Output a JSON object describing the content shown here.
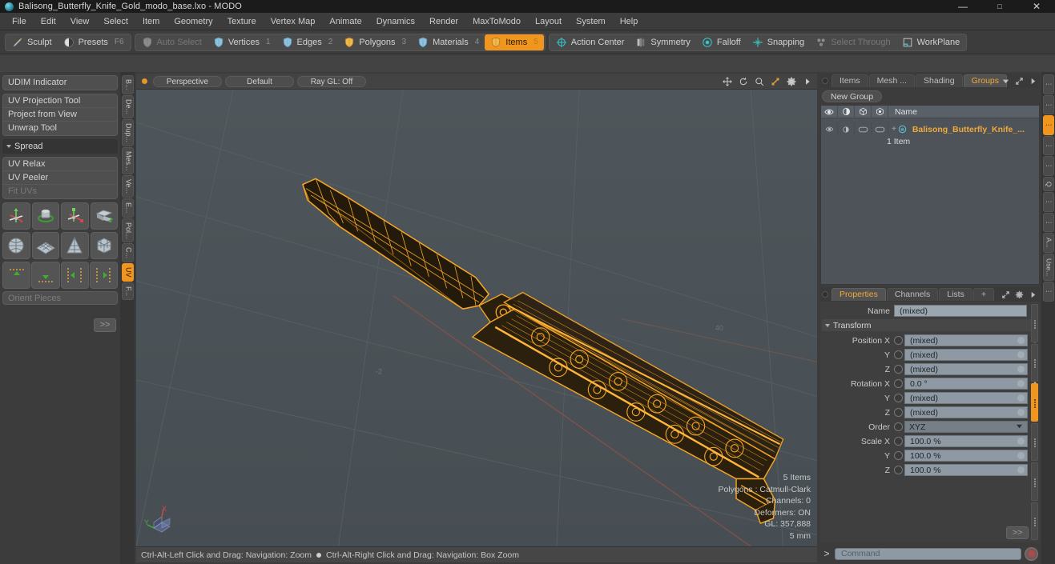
{
  "window": {
    "title": "Balisong_Butterfly_Knife_Gold_modo_base.lxo - MODO",
    "app_icon": "modo-sphere-icon",
    "minimize": "—",
    "maximize": "▢",
    "close": "✕"
  },
  "menubar": {
    "items": [
      "File",
      "Edit",
      "View",
      "Select",
      "Item",
      "Geometry",
      "Texture",
      "Vertex Map",
      "Animate",
      "Dynamics",
      "Render",
      "MaxToModo",
      "Layout",
      "System",
      "Help"
    ]
  },
  "toolbar": {
    "group_left": [
      {
        "label": "Sculpt",
        "icon": "sculpt-brush-icon",
        "state": "normal",
        "shortcut": ""
      },
      {
        "label": "Presets",
        "icon": "presets-sphere-icon",
        "state": "normal",
        "shortcut": "F6"
      }
    ],
    "group_mode": [
      {
        "label": "Auto Select",
        "icon": "shield-icon",
        "state": "dim",
        "shortcut": ""
      },
      {
        "label": "Vertices",
        "icon": "shield-icon",
        "state": "normal",
        "shortcut": "1"
      },
      {
        "label": "Edges",
        "icon": "shield-icon",
        "state": "normal",
        "shortcut": "2"
      },
      {
        "label": "Polygons",
        "icon": "shield-icon",
        "state": "normal",
        "shortcut": "3"
      },
      {
        "label": "Materials",
        "icon": "shield-icon",
        "state": "normal",
        "shortcut": "4"
      },
      {
        "label": "Items",
        "icon": "shield-icon",
        "state": "active",
        "shortcut": "5"
      }
    ],
    "group_right": [
      {
        "label": "Action Center",
        "icon": "action-center-icon",
        "state": "normal"
      },
      {
        "label": "Symmetry",
        "icon": "symmetry-icon",
        "state": "normal"
      },
      {
        "label": "Falloff",
        "icon": "falloff-icon",
        "state": "normal"
      },
      {
        "label": "Snapping",
        "icon": "snapping-icon",
        "state": "normal"
      },
      {
        "label": "Select Through",
        "icon": "select-through-icon",
        "state": "dim"
      },
      {
        "label": "WorkPlane",
        "icon": "workplane-icon",
        "state": "normal"
      }
    ]
  },
  "left_panel": {
    "group_one": [
      {
        "label": "UDIM Indicator",
        "disabled": false
      }
    ],
    "group_two": [
      {
        "label": "UV Projection Tool",
        "disabled": false
      },
      {
        "label": "Project from View",
        "disabled": false
      },
      {
        "label": "Unwrap Tool",
        "disabled": false
      }
    ],
    "section": {
      "label": "Spread",
      "expanded": true
    },
    "group_three": [
      {
        "label": "UV Relax",
        "disabled": false
      },
      {
        "label": "UV Peeler",
        "disabled": false
      },
      {
        "label": "Fit UVs",
        "disabled": true
      }
    ],
    "icon_rows": [
      [
        "uv-move-gizmo-icon",
        "uv-rotate-gizmo-icon",
        "uv-scale-gizmo-icon",
        "uv-flip-icon"
      ],
      [
        "uv-sphere-map-icon",
        "uv-grid-map-icon",
        "uv-cone-map-icon",
        "uv-box-map-icon"
      ],
      [
        "align-up-icon",
        "align-down-icon",
        "align-left-icon",
        "align-right-icon"
      ]
    ],
    "orient_pieces": "Orient Pieces",
    "more_button": ">>",
    "vtabs": [
      {
        "label": "B...",
        "active": false
      },
      {
        "label": "De...",
        "active": false
      },
      {
        "label": "Dup...",
        "active": false
      },
      {
        "label": "Mes...",
        "active": false
      },
      {
        "label": "Ve...",
        "active": false
      },
      {
        "label": "E...",
        "active": false
      },
      {
        "label": "Pol...",
        "active": false
      },
      {
        "label": "C...",
        "active": false
      },
      {
        "label": "UV",
        "active": true
      },
      {
        "label": "F...",
        "active": false
      }
    ]
  },
  "viewport": {
    "header": {
      "indicator": "active-viewport-dot",
      "buttons": [
        "Perspective",
        "Default",
        "Ray GL: Off"
      ],
      "tool_icons": [
        "pan-icon",
        "rotate-icon",
        "zoom-icon",
        "fit-icon",
        "gear-icon",
        "chevron-right-icon"
      ]
    },
    "stats": [
      "5 Items",
      "Polygons : Catmull-Clark",
      "Channels: 0",
      "Deformers: ON",
      "GL: 357,888",
      "5 mm"
    ],
    "axis_gizmo": {
      "x": "X",
      "y": "Y",
      "z": "Z"
    },
    "model": "balisong-butterfly-knife-wireframe",
    "wire_color": "#f5a623",
    "background_color": "#4b5257"
  },
  "statusbar": {
    "left_hint": "Ctrl-Alt-Left Click and Drag: Navigation: Zoom",
    "right_hint": "Ctrl-Alt-Right Click and Drag: Navigation: Box Zoom"
  },
  "right_panel": {
    "top_tabs": [
      {
        "label": "Items",
        "active": false
      },
      {
        "label": "Mesh ...",
        "active": false
      },
      {
        "label": "Shading",
        "active": false
      },
      {
        "label": "Groups",
        "active": true
      }
    ],
    "top_tab_tools": [
      "chevron-down-icon",
      "expand-icon",
      "chevron-right-icon"
    ],
    "new_group_button": "New Group",
    "list_columns": [
      "visibility-eye-icon",
      "shading-icon",
      "render-icon",
      "select-icon",
      "Name"
    ],
    "list_rows": [
      {
        "name": "Balisong_Butterfly_Knife_...",
        "subtitle": "1 Item",
        "selected": true,
        "icon": "group-item-icon"
      }
    ],
    "properties": {
      "tabs": [
        {
          "label": "Properties",
          "active": true
        },
        {
          "label": "Channels",
          "active": false
        },
        {
          "label": "Lists",
          "active": false
        },
        {
          "label": "+",
          "active": false
        }
      ],
      "tab_tools": [
        "expand-icon",
        "gear-icon",
        "chevron-right-icon"
      ],
      "name_label": "Name",
      "name_value": "(mixed)",
      "transform_section": "Transform",
      "fields": [
        {
          "label": "Position X",
          "value": "(mixed)",
          "type": "number"
        },
        {
          "label": "Y",
          "value": "(mixed)",
          "type": "number"
        },
        {
          "label": "Z",
          "value": "(mixed)",
          "type": "number"
        },
        {
          "label": "Rotation X",
          "value": "0.0 °",
          "type": "number"
        },
        {
          "label": "Y",
          "value": "(mixed)",
          "type": "number"
        },
        {
          "label": "Z",
          "value": "(mixed)",
          "type": "number"
        },
        {
          "label": "Order",
          "value": "XYZ",
          "type": "select"
        },
        {
          "label": "Scale X",
          "value": "100.0 %",
          "type": "number"
        },
        {
          "label": "Y",
          "value": "100.0 %",
          "type": "number"
        },
        {
          "label": "Z",
          "value": "100.0 %",
          "type": "number"
        }
      ],
      "more_button": ">>"
    },
    "command_bar": {
      "prompt": ">",
      "placeholder": "Command",
      "record_button": "record-command-icon"
    },
    "vtabs": [
      {
        "label": "",
        "active": false,
        "dots": true
      },
      {
        "label": "",
        "active": false,
        "dots": true
      },
      {
        "label": "",
        "active": true,
        "dots": true
      },
      {
        "label": "",
        "active": false,
        "dots": true
      },
      {
        "label": "",
        "active": false,
        "dots": true
      },
      {
        "label": "Q",
        "active": false,
        "dots": false
      },
      {
        "label": "",
        "active": false,
        "dots": true
      },
      {
        "label": "",
        "active": false,
        "dots": true
      },
      {
        "label": "A...",
        "active": false,
        "dots": false
      },
      {
        "label": "Use...",
        "active": false,
        "dots": false
      },
      {
        "label": "",
        "active": false,
        "dots": true
      }
    ]
  }
}
